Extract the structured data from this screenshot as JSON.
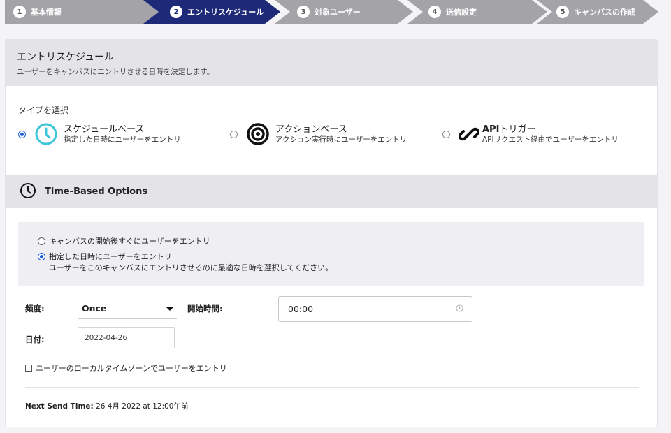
{
  "stepper": [
    {
      "num": "1",
      "label": "基本情報"
    },
    {
      "num": "2",
      "label": "エントリスケジュール"
    },
    {
      "num": "3",
      "label": "対象ユーザー"
    },
    {
      "num": "4",
      "label": "送信設定"
    },
    {
      "num": "5",
      "label": "キャンバスの作成"
    }
  ],
  "active_step": 2,
  "colors": {
    "step_inactive": "#a4a4a8",
    "step_active": "#1e2a78",
    "radio_selected": "#1a5cd8",
    "clock_icon": "#3cc4d8"
  },
  "header": {
    "title": "エントリスケジュール",
    "subtitle": "ユーザーをキャンバスにエントリさせる日時を決定します。"
  },
  "type_select": {
    "label": "タイプを選択",
    "selected": "schedule",
    "options": [
      {
        "id": "schedule",
        "icon": "clock-icon",
        "name": "スケジュールベース",
        "desc": "指定した日時にユーザーをエントリ"
      },
      {
        "id": "action",
        "icon": "target-icon",
        "name": "アクションベース",
        "desc": "アクション実行時にユーザーをエントリ"
      },
      {
        "id": "api",
        "icon": "link-icon",
        "name_bold": "API",
        "name_rest": "トリガー",
        "desc": "APIリクエスト経由でユーザーをエントリ"
      }
    ]
  },
  "time_based": {
    "title": "Time-Based Options",
    "icon": "clock-outline-icon",
    "option_immediate": "キャンバスの開始後すぐにユーザーをエントリ",
    "option_scheduled": "指定した日時にユーザーをエントリ",
    "option_scheduled_sub": "ユーザーをこのキャンバスにエントリさせるのに最適な日時を選択してください。",
    "selected": "scheduled"
  },
  "form": {
    "frequency_label": "頻度:",
    "frequency_value": "Once",
    "start_time_label": "開始時間:",
    "start_time_value": "00:00",
    "date_label": "日付:",
    "date_value": "2022-04-26",
    "local_tz_label": "ユーザーのローカルタイムゾーンでユーザーをエントリ",
    "local_tz_checked": false
  },
  "next_send": {
    "label": "Next Send Time:",
    "value": "26 4月 2022 at 12:00午前"
  }
}
